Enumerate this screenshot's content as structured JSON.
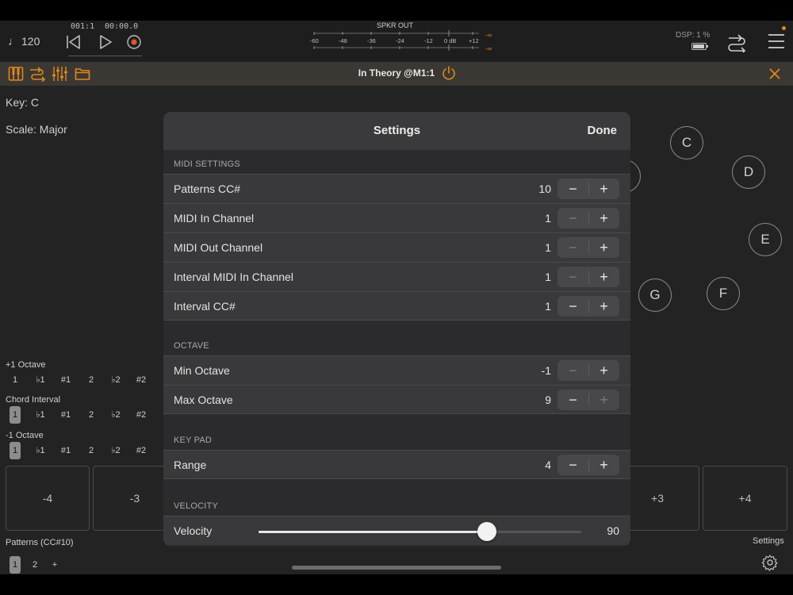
{
  "transport": {
    "tempo": "120",
    "bars": "001:1",
    "time": "00:00.0",
    "meter_label": "SPKR OUT",
    "meter_scale": [
      "-60",
      "-48",
      "-36",
      "-24",
      "-12",
      "0 dB",
      "+12"
    ],
    "meter_peak": "-∞",
    "dsp": "DSP: 1 %"
  },
  "plugin": {
    "title": "In Theory @M1:1"
  },
  "main": {
    "key": "Key: C",
    "scale": "Scale: Major",
    "notes": [
      "C",
      "D",
      "E",
      "F",
      "G"
    ],
    "rows": [
      {
        "label": "+1 Octave",
        "items": [
          "1",
          "♭1",
          "#1",
          "2",
          "♭2",
          "#2"
        ]
      },
      {
        "label": "Chord Interval",
        "items": [
          "1",
          "♭1",
          "#1",
          "2",
          "♭2",
          "#2"
        ]
      },
      {
        "label": "-1 Octave",
        "items": [
          "1",
          "♭1",
          "#1",
          "2",
          "♭2",
          "#2"
        ]
      }
    ],
    "pads": [
      "-4",
      "-3",
      "+3",
      "+4"
    ],
    "patterns_label": "Patterns (CC#10)",
    "pattern_tabs": [
      "1",
      "2",
      "+"
    ],
    "settings_label": "Settings"
  },
  "modal": {
    "title": "Settings",
    "done": "Done",
    "sections": {
      "midi": "MIDI SETTINGS",
      "octave": "OCTAVE",
      "keypad": "KEY PAD",
      "velocity": "VELOCITY"
    },
    "rows": {
      "patterns_cc": {
        "label": "Patterns CC#",
        "value": "10"
      },
      "midi_in": {
        "label": "MIDI In Channel",
        "value": "1"
      },
      "midi_out": {
        "label": "MIDI Out Channel",
        "value": "1"
      },
      "interval_midi_in": {
        "label": "Interval MIDI In Channel",
        "value": "1"
      },
      "interval_cc": {
        "label": "Interval CC#",
        "value": "1"
      },
      "min_octave": {
        "label": "Min Octave",
        "value": "-1"
      },
      "max_octave": {
        "label": "Max Octave",
        "value": "9"
      },
      "range": {
        "label": "Range",
        "value": "4"
      }
    },
    "velocity": {
      "label": "Velocity",
      "value": "90",
      "max": 127
    },
    "stepper": {
      "minus": "−",
      "plus": "+"
    }
  }
}
